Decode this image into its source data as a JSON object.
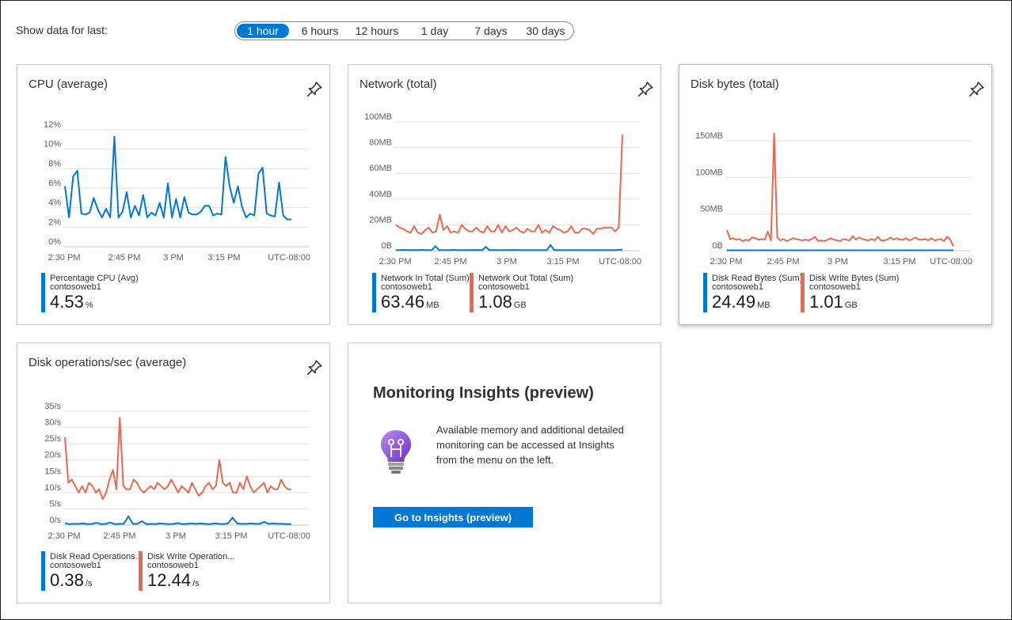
{
  "header": {
    "range_label": "Show data for last:",
    "ranges": [
      "1 hour",
      "6 hours",
      "12 hours",
      "1 day",
      "7 days",
      "30 days"
    ],
    "selected_range": "1 hour"
  },
  "tiles": {
    "cpu": {
      "title": "CPU (average)",
      "legends": [
        {
          "name": "Percentage CPU (Avg)",
          "resource": "contosoweb1",
          "value": "4.53",
          "unit": "%",
          "color": "#0078d4"
        }
      ]
    },
    "network": {
      "title": "Network (total)",
      "legends": [
        {
          "name": "Network In Total (Sum)",
          "resource": "contosoweb1",
          "value": "63.46",
          "unit": "MB",
          "color": "#0078d4"
        },
        {
          "name": "Network Out Total (Sum)",
          "resource": "contosoweb1",
          "value": "1.08",
          "unit": "GB",
          "color": "#e8694f"
        }
      ]
    },
    "disk_bytes": {
      "title": "Disk bytes (total)",
      "legends": [
        {
          "name": "Disk Read Bytes (Sum)",
          "resource": "contosoweb1",
          "value": "24.49",
          "unit": "MB",
          "color": "#0078d4"
        },
        {
          "name": "Disk Write Bytes (Sum)",
          "resource": "contosoweb1",
          "value": "1.01",
          "unit": "GB",
          "color": "#e8694f"
        }
      ]
    },
    "disk_ops": {
      "title": "Disk operations/sec (average)",
      "legends": [
        {
          "name": "Disk Read Operations...",
          "resource": "contosoweb1",
          "value": "0.38",
          "unit": "/s",
          "color": "#0078d4"
        },
        {
          "name": "Disk Write Operation...",
          "resource": "contosoweb1",
          "value": "12.44",
          "unit": "/s",
          "color": "#e8694f"
        }
      ]
    },
    "insights": {
      "title": "Monitoring Insights (preview)",
      "text": "Available memory and additional detailed monitoring can be accessed at Insights from the menu on the left.",
      "button_label": "Go to Insights (preview)",
      "icon": "lightbulb-icon"
    }
  },
  "chart_data": [
    {
      "type": "line",
      "title": "CPU (average)",
      "x_ticks": [
        "2:30 PM",
        "2:45 PM",
        "3 PM",
        "3:15 PM"
      ],
      "timezone": "UTC-08:00",
      "y_ticks": [
        "0%",
        "2%",
        "4%",
        "6%",
        "8%",
        "10%",
        "12%"
      ],
      "ylim": [
        0,
        12
      ],
      "series": [
        {
          "name": "Percentage CPU (Avg)",
          "color": "#0078d4",
          "values": [
            6.2,
            3.0,
            7.2,
            7.8,
            3.4,
            3.3,
            3.5,
            5.0,
            3.8,
            3.0,
            3.9,
            3.0,
            11.3,
            3.0,
            3.6,
            5.6,
            3.0,
            4.2,
            3.2,
            5.3,
            3.0,
            3.5,
            3.2,
            4.5,
            3.0,
            6.5,
            3.0,
            4.9,
            3.0,
            5.1,
            3.5,
            3.3,
            3.3,
            3.6,
            4.2,
            4.2,
            3.2,
            3.4,
            3.3,
            9.2,
            6.2,
            4.5,
            6.2,
            4.1,
            3.0,
            3.4,
            3.2,
            7.5,
            8.1,
            3.4,
            3.2,
            3.1,
            6.6,
            3.2,
            2.8,
            2.8
          ]
        }
      ]
    },
    {
      "type": "line",
      "title": "Network (total)",
      "x_ticks": [
        "2:30 PM",
        "2:45 PM",
        "3 PM",
        "3:15 PM"
      ],
      "timezone": "UTC-08:00",
      "y_ticks": [
        "0B",
        "20MB",
        "40MB",
        "60MB",
        "80MB",
        "100MB"
      ],
      "ylim": [
        0,
        100
      ],
      "series": [
        {
          "name": "Network In Total (Sum)",
          "color": "#0078d4",
          "values": [
            0.5,
            0.5,
            0.6,
            0.5,
            0.5,
            0.5,
            0.5,
            0.6,
            0.5,
            0.5,
            0.5,
            3.5,
            0.5,
            0.5,
            0.5,
            0.5,
            0.6,
            0.5,
            0.5,
            0.5,
            0.5,
            0.5,
            0.6,
            0.5,
            0.5,
            3.0,
            0.5,
            0.5,
            0.5,
            0.5,
            0.5,
            0.5,
            0.5,
            0.6,
            0.5,
            0.5,
            0.5,
            0.5,
            0.5,
            0.5,
            0.5,
            0.5,
            0.5,
            4.5,
            0.5,
            0.5,
            0.5,
            0.5,
            0.5,
            0.5,
            0.5,
            0.5,
            0.5,
            0.5,
            0.5,
            0.5,
            0.5,
            0.5,
            0.5,
            0.5,
            0.5,
            0.5,
            0.8,
            0.8
          ]
        },
        {
          "name": "Network Out Total (Sum)",
          "color": "#e8694f",
          "values": [
            20,
            18,
            17,
            15,
            14,
            19,
            14,
            13,
            16,
            18,
            14,
            15,
            28,
            16,
            19,
            14,
            15,
            14,
            20,
            17,
            15,
            15,
            18,
            15,
            14,
            19,
            15,
            15,
            20,
            14,
            19,
            15,
            16,
            18,
            15,
            14,
            17,
            15,
            15,
            20,
            14,
            16,
            14,
            19,
            17,
            16,
            14,
            15,
            19,
            14,
            14,
            17,
            17,
            16,
            13,
            17,
            17,
            18,
            18,
            18,
            15,
            18,
            90
          ]
        }
      ]
    },
    {
      "type": "line",
      "title": "Disk bytes (total)",
      "x_ticks": [
        "2:30 PM",
        "2:45 PM",
        "3 PM",
        "3:15 PM"
      ],
      "timezone": "UTC-08:00",
      "y_ticks": [
        "0B",
        "50MB",
        "100MB",
        "150MB"
      ],
      "ylim": [
        0,
        165
      ],
      "series": [
        {
          "name": "Disk Read Bytes (Sum)",
          "color": "#0078d4",
          "values": [
            0.5,
            0.5,
            0.5,
            0.5,
            0.5,
            0.5,
            0.5,
            0.5,
            0.5,
            0.5,
            0.5,
            0.5,
            0.5,
            0.5,
            0.5,
            0.5,
            0.5,
            0.5,
            0.5,
            0.5,
            0.5,
            0.5,
            0.5,
            0.5,
            0.5,
            0.5,
            0.5,
            0.5,
            0.5,
            0.5,
            0.5,
            0.5,
            0.5,
            0.5,
            0.5,
            0.5,
            0.5,
            0.5,
            0.5,
            0.5,
            0.5,
            0.5,
            0.5,
            0.5,
            0.5,
            0.5,
            0.5,
            0.5,
            0.5,
            0.5,
            0.5,
            0.5,
            0.5,
            0.5,
            0.5,
            0.5,
            0.5,
            0.5,
            0.5,
            0.5,
            0.5,
            0.5,
            0.5,
            0.5,
            0.5,
            0.5,
            0.5,
            0.5,
            0.5,
            0.5,
            0.5,
            0.5,
            0.5,
            0.5,
            0.5,
            0.5,
            0.5,
            0.5,
            0.5,
            0.5,
            0.5,
            0.5,
            0.5,
            0.5,
            0.5,
            0.5,
            0.5,
            0.5,
            0.5,
            0.5,
            0.5,
            0.5,
            0.5,
            0.5,
            0.5,
            0.5,
            0.5,
            0.5,
            0.5,
            0.5,
            0.5,
            0.5,
            0.5,
            0.5,
            0.5,
            0.5,
            0.5,
            0.5,
            0.5,
            0.5,
            0.5,
            0.5,
            0.5,
            0.5,
            0.5,
            0.5,
            0.5,
            0.5,
            0.5,
            0.5,
            0.5,
            0.5,
            0.5,
            0.5,
            0.5,
            0.5,
            0.5,
            0.5,
            0.5,
            0.5,
            0.5,
            0.5,
            0.5,
            0.5,
            0.5,
            0.5,
            0.5,
            0.5,
            0.5,
            0.5,
            0.5,
            0.5,
            0.5,
            0.5,
            0.5
          ]
        },
        {
          "name": "Disk Write Bytes (Sum)",
          "color": "#e8694f",
          "values": [
            28,
            16,
            17,
            15,
            16,
            13,
            15,
            14,
            18,
            17,
            15,
            16,
            15,
            26,
            14,
            160,
            18,
            14,
            16,
            13,
            15,
            17,
            16,
            15,
            14,
            15,
            14,
            16,
            19,
            13,
            14,
            13,
            15,
            17,
            15,
            14,
            13,
            16,
            15,
            14,
            20,
            15,
            18,
            16,
            15,
            14,
            16,
            14,
            19,
            14,
            14,
            15,
            18,
            15,
            17,
            15,
            15,
            17,
            14,
            16,
            18,
            15,
            15,
            16,
            14,
            17,
            14,
            15,
            16,
            13,
            19,
            15,
            6
          ]
        }
      ]
    },
    {
      "type": "line",
      "title": "Disk operations/sec (average)",
      "x_ticks": [
        "2:30 PM",
        "2:45 PM",
        "3 PM",
        "3:15 PM"
      ],
      "timezone": "UTC-08:00",
      "y_ticks": [
        "0/s",
        "5/s",
        "10/s",
        "15/s",
        "20/s",
        "25/s",
        "30/s",
        "35/s"
      ],
      "ylim": [
        0,
        35
      ],
      "series": [
        {
          "name": "Disk Read Operations...",
          "color": "#0078d4",
          "values": [
            0.6,
            0.3,
            0.4,
            0.4,
            0.5,
            0.3,
            0.4,
            0.7,
            0.3,
            0.4,
            0.8,
            0.3,
            0.4,
            0.4,
            2.7,
            0.4,
            0.4,
            1.2,
            0.3,
            0.4,
            0.3,
            0.5,
            0.4,
            0.3,
            0.4,
            0.6,
            0.3,
            0.4,
            0.5,
            0.4,
            0.5,
            0.4,
            0.3,
            0.5,
            0.4,
            0.3,
            0.5,
            2.3,
            0.5,
            0.4,
            0.4,
            0.5,
            0.4,
            0.4,
            1.0,
            0.4,
            0.5,
            0.4,
            0.4,
            0.3,
            0.3
          ]
        },
        {
          "name": "Disk Write Operation...",
          "color": "#e8694f",
          "values": [
            27,
            13,
            14,
            12,
            10,
            12,
            10,
            13,
            12,
            10,
            11,
            8,
            10,
            14,
            17,
            11,
            33,
            12,
            11,
            11,
            14,
            13,
            11,
            10,
            11,
            12,
            11,
            13,
            12,
            11,
            12,
            14,
            12,
            10,
            12,
            11,
            10,
            13,
            11,
            9,
            10,
            12,
            13,
            11,
            12,
            20,
            13,
            12,
            13,
            10,
            10,
            13,
            11,
            15,
            12,
            10,
            11,
            12,
            13,
            10,
            12,
            11,
            11,
            14,
            12,
            11,
            11
          ]
        }
      ]
    }
  ]
}
